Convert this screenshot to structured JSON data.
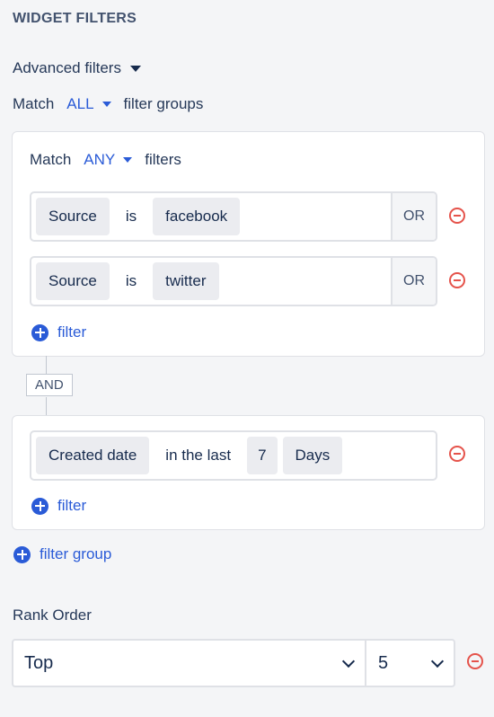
{
  "header": {
    "title": "WIDGET FILTERS"
  },
  "advanced": {
    "label": "Advanced filters"
  },
  "outer_match": {
    "prefix": "Match",
    "value": "ALL",
    "suffix": "filter groups"
  },
  "group1": {
    "match": {
      "prefix": "Match",
      "value": "ANY",
      "suffix": "filters"
    },
    "filters": [
      {
        "field": "Source",
        "operator": "is",
        "value": "facebook",
        "joiner": "OR"
      },
      {
        "field": "Source",
        "operator": "is",
        "value": "twitter",
        "joiner": "OR"
      }
    ],
    "add_label": "filter"
  },
  "group_joiner": "AND",
  "group2": {
    "filter": {
      "field": "Created date",
      "operator": "in the last",
      "amount": "7",
      "unit": "Days"
    },
    "add_label": "filter"
  },
  "add_group_label": "filter group",
  "rank": {
    "label": "Rank Order",
    "order_value": "Top",
    "count_value": "5"
  },
  "colors": {
    "accent": "#2a5bd7",
    "remove": "#e5534b",
    "border": "#dfe1e6"
  }
}
